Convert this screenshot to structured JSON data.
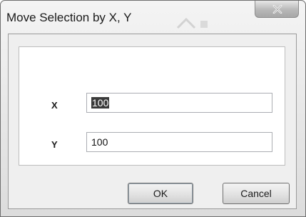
{
  "dialog": {
    "title": "Move Selection by X, Y",
    "close_icon": "close-icon"
  },
  "fields": {
    "x": {
      "label": "X",
      "value": "100"
    },
    "y": {
      "label": "Y",
      "value": "100"
    }
  },
  "buttons": {
    "ok": "OK",
    "cancel": "Cancel"
  }
}
